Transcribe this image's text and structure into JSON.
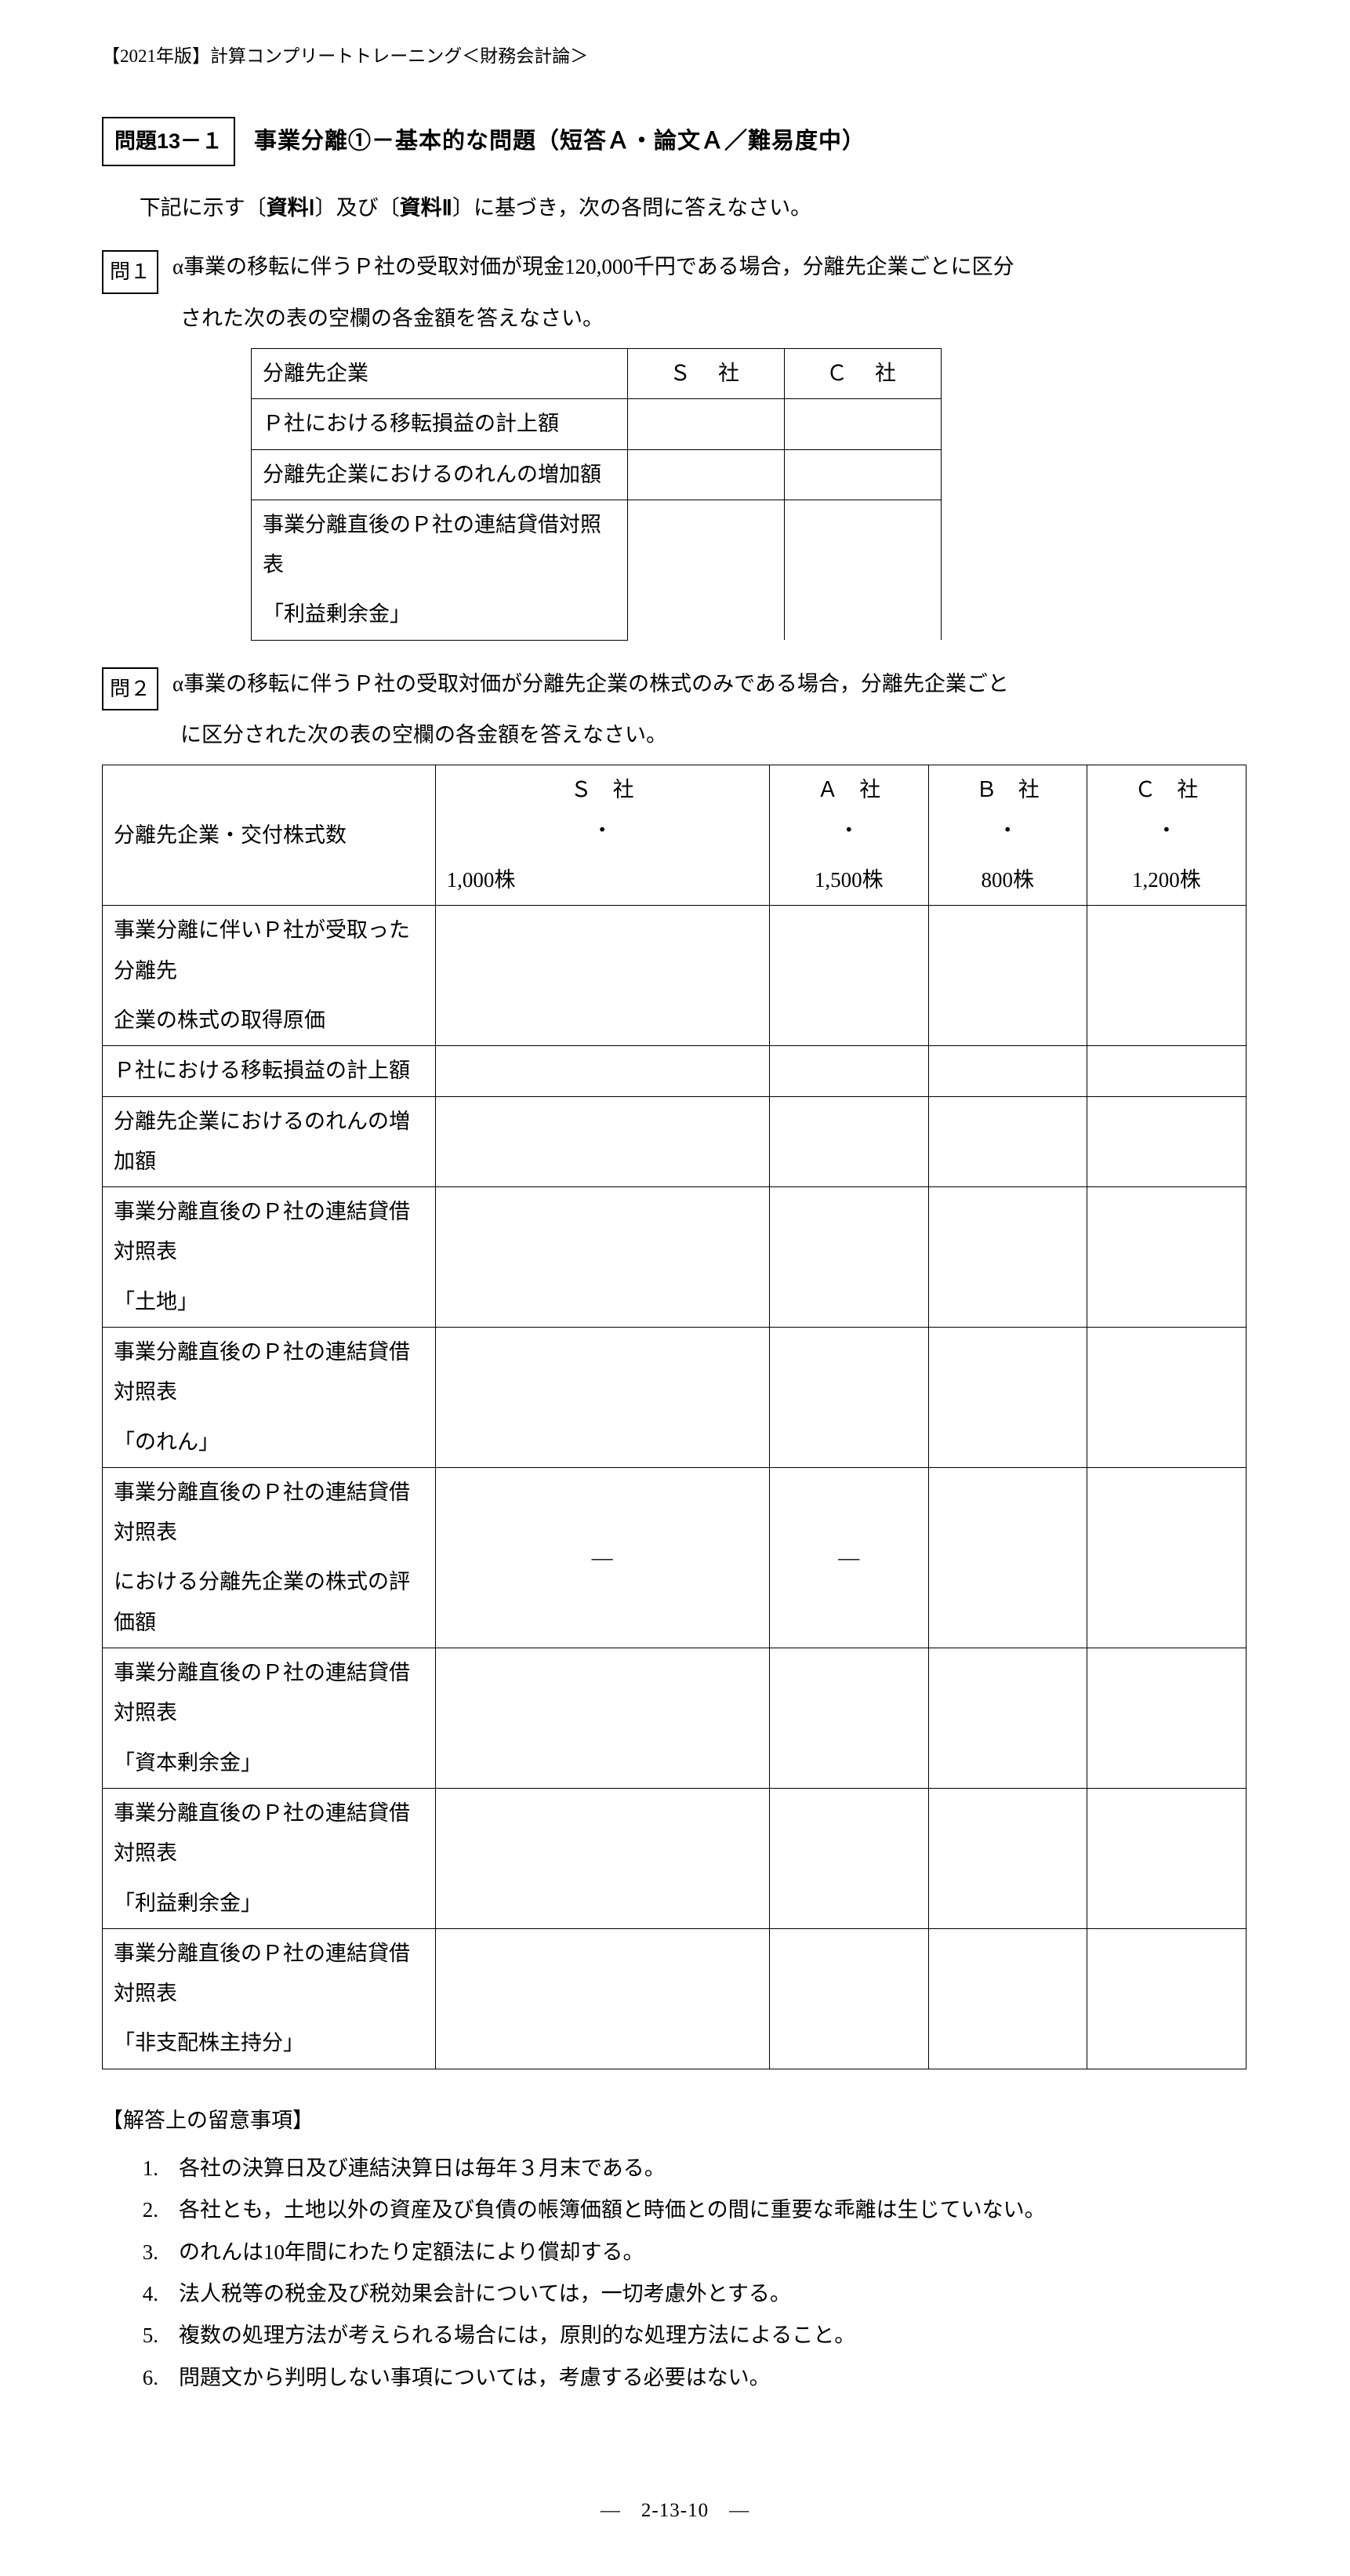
{
  "header": "【2021年版】計算コンプリートトレーニング＜財務会計論＞",
  "problem_number_box": "問題13－１",
  "problem_title": "事業分離①－基本的な問題（短答Ａ・論文Ａ／難易度中）",
  "lead": "下記に示す〔資料Ⅰ〕及び〔資料Ⅱ〕に基づき，次の各問に答えなさい。",
  "mon1_box": "問１",
  "mon1_text": "α事業の移転に伴うＰ社の受取対価が現金120,000千円である場合，分離先企業ごとに区分",
  "mon1_cont": "された次の表の空欄の各金額を答えなさい。",
  "table1": {
    "header": {
      "c0": "分離先企業",
      "c1": "Ｓ　社",
      "c2": "Ｃ　社"
    },
    "rows": [
      "Ｐ社における移転損益の計上額",
      "分離先企業におけるのれんの増加額"
    ],
    "row3a": "事業分離直後のＰ社の連結貸借対照表",
    "row3b": "「利益剰余金」"
  },
  "mon2_box": "問２",
  "mon2_text": "α事業の移転に伴うＰ社の受取対価が分離先企業の株式のみである場合，分離先企業ごと",
  "mon2_cont": "に区分された次の表の空欄の各金額を答えなさい。",
  "table2": {
    "header_l1": "分離先企業・交付株式数",
    "cols": [
      {
        "name": "Ｓ　社",
        "shares": "1,000株"
      },
      {
        "name": "Ａ　社",
        "shares": "1,500株"
      },
      {
        "name": "Ｂ　社",
        "shares": "800株"
      },
      {
        "name": "Ｃ　社",
        "shares": "1,200株"
      }
    ],
    "rows": [
      {
        "a": "事業分離に伴いＰ社が受取った分離先",
        "b": "企業の株式の取得原価",
        "vals": [
          "",
          "",
          "",
          ""
        ]
      },
      {
        "a": "Ｐ社における移転損益の計上額",
        "vals": [
          "",
          "",
          "",
          ""
        ]
      },
      {
        "a": "分離先企業におけるのれんの増加額",
        "vals": [
          "",
          "",
          "",
          ""
        ]
      },
      {
        "a": "事業分離直後のＰ社の連結貸借対照表",
        "b": "「土地」",
        "vals": [
          "",
          "",
          "",
          ""
        ]
      },
      {
        "a": "事業分離直後のＰ社の連結貸借対照表",
        "b": "「のれん」",
        "vals": [
          "",
          "",
          "",
          ""
        ]
      },
      {
        "a": "事業分離直後のＰ社の連結貸借対照表",
        "b": "における分離先企業の株式の評価額",
        "vals": [
          "―",
          "―",
          "",
          ""
        ]
      },
      {
        "a": "事業分離直後のＰ社の連結貸借対照表",
        "b": "「資本剰余金」",
        "vals": [
          "",
          "",
          "",
          ""
        ]
      },
      {
        "a": "事業分離直後のＰ社の連結貸借対照表",
        "b": "「利益剰余金」",
        "vals": [
          "",
          "",
          "",
          ""
        ]
      },
      {
        "a": "事業分離直後のＰ社の連結貸借対照表",
        "b": "「非支配株主持分」",
        "vals": [
          "",
          "",
          "",
          ""
        ]
      }
    ]
  },
  "notes_title": "【解答上の留意事項】",
  "notes": [
    "各社の決算日及び連結決算日は毎年３月末である。",
    "各社とも，土地以外の資産及び負債の帳簿価額と時価との間に重要な乖離は生じていない。",
    "のれんは10年間にわたり定額法により償却する。",
    "法人税等の税金及び税効果会計については，一切考慮外とする。",
    "複数の処理方法が考えられる場合には，原則的な処理方法によること。",
    "問題文から判明しない事項については，考慮する必要はない。"
  ],
  "page_number": "―　2-13-10　―",
  "bold_run_1": "資料Ⅰ",
  "bold_run_2": "資料Ⅱ",
  "sep": "・"
}
